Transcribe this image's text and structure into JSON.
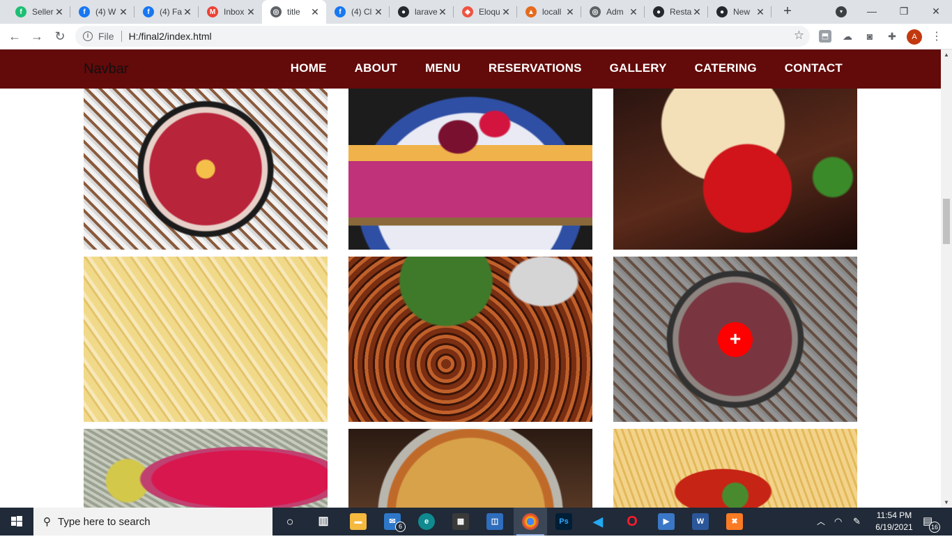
{
  "browser": {
    "tabs": [
      {
        "title": "Seller",
        "color": "#1dbf73",
        "glyph": "f"
      },
      {
        "title": "(4) W",
        "color": "#1877f2",
        "glyph": "f"
      },
      {
        "title": "(4) Fa",
        "color": "#1877f2",
        "glyph": "f"
      },
      {
        "title": "Inbox",
        "color": "#ea4335",
        "glyph": "M"
      },
      {
        "title": "title",
        "color": "#5f6368",
        "glyph": "◎"
      },
      {
        "title": "(4) Cl",
        "color": "#1877f2",
        "glyph": "f"
      },
      {
        "title": "larave",
        "color": "#24292e",
        "glyph": "●"
      },
      {
        "title": "Eloqu",
        "color": "#f05340",
        "glyph": "◆"
      },
      {
        "title": "locall",
        "color": "#e56b1f",
        "glyph": "▲"
      },
      {
        "title": "Adm",
        "color": "#5f6368",
        "glyph": "◎"
      },
      {
        "title": "Resta",
        "color": "#24292e",
        "glyph": "●"
      },
      {
        "title": "New",
        "color": "#24292e",
        "glyph": "●"
      }
    ],
    "new_tab_glyph": "+",
    "window_controls": {
      "minimize": "—",
      "restore": "❐",
      "close": "✕"
    },
    "toolbar": {
      "back": "←",
      "forward": "→",
      "reload": "↻",
      "protocol": "File",
      "url": "H:/final2/index.html",
      "star": "☆",
      "profile_initial": "A"
    }
  },
  "site": {
    "brand": "Navbar",
    "nav": [
      "HOME",
      "ABOUT",
      "MENU",
      "RESERVATIONS",
      "GALLERY",
      "CATERING",
      "CONTACT"
    ],
    "gallery": [
      {
        "name": "pizza-salami",
        "hover": false
      },
      {
        "name": "berry-cheesecake",
        "hover": false
      },
      {
        "name": "ice-cream-strawberry",
        "hover": false
      },
      {
        "name": "penne-pasta",
        "hover": false
      },
      {
        "name": "grilled-chicken-wings",
        "hover": false
      },
      {
        "name": "pizza-salami-hover",
        "hover": true
      },
      {
        "name": "pink-dessert",
        "hover": false
      },
      {
        "name": "pepperoni-pizza",
        "hover": false
      },
      {
        "name": "fusilli-tomato",
        "hover": false
      }
    ],
    "overlay_glyph": "+"
  },
  "taskbar": {
    "search_placeholder": "Type here to search",
    "mail_badge": "6",
    "notification_badge": "16",
    "time": "11:54 PM",
    "date": "6/19/2021"
  },
  "colors": {
    "navbar": "#630a0a",
    "plus_button": "#ff0000"
  }
}
